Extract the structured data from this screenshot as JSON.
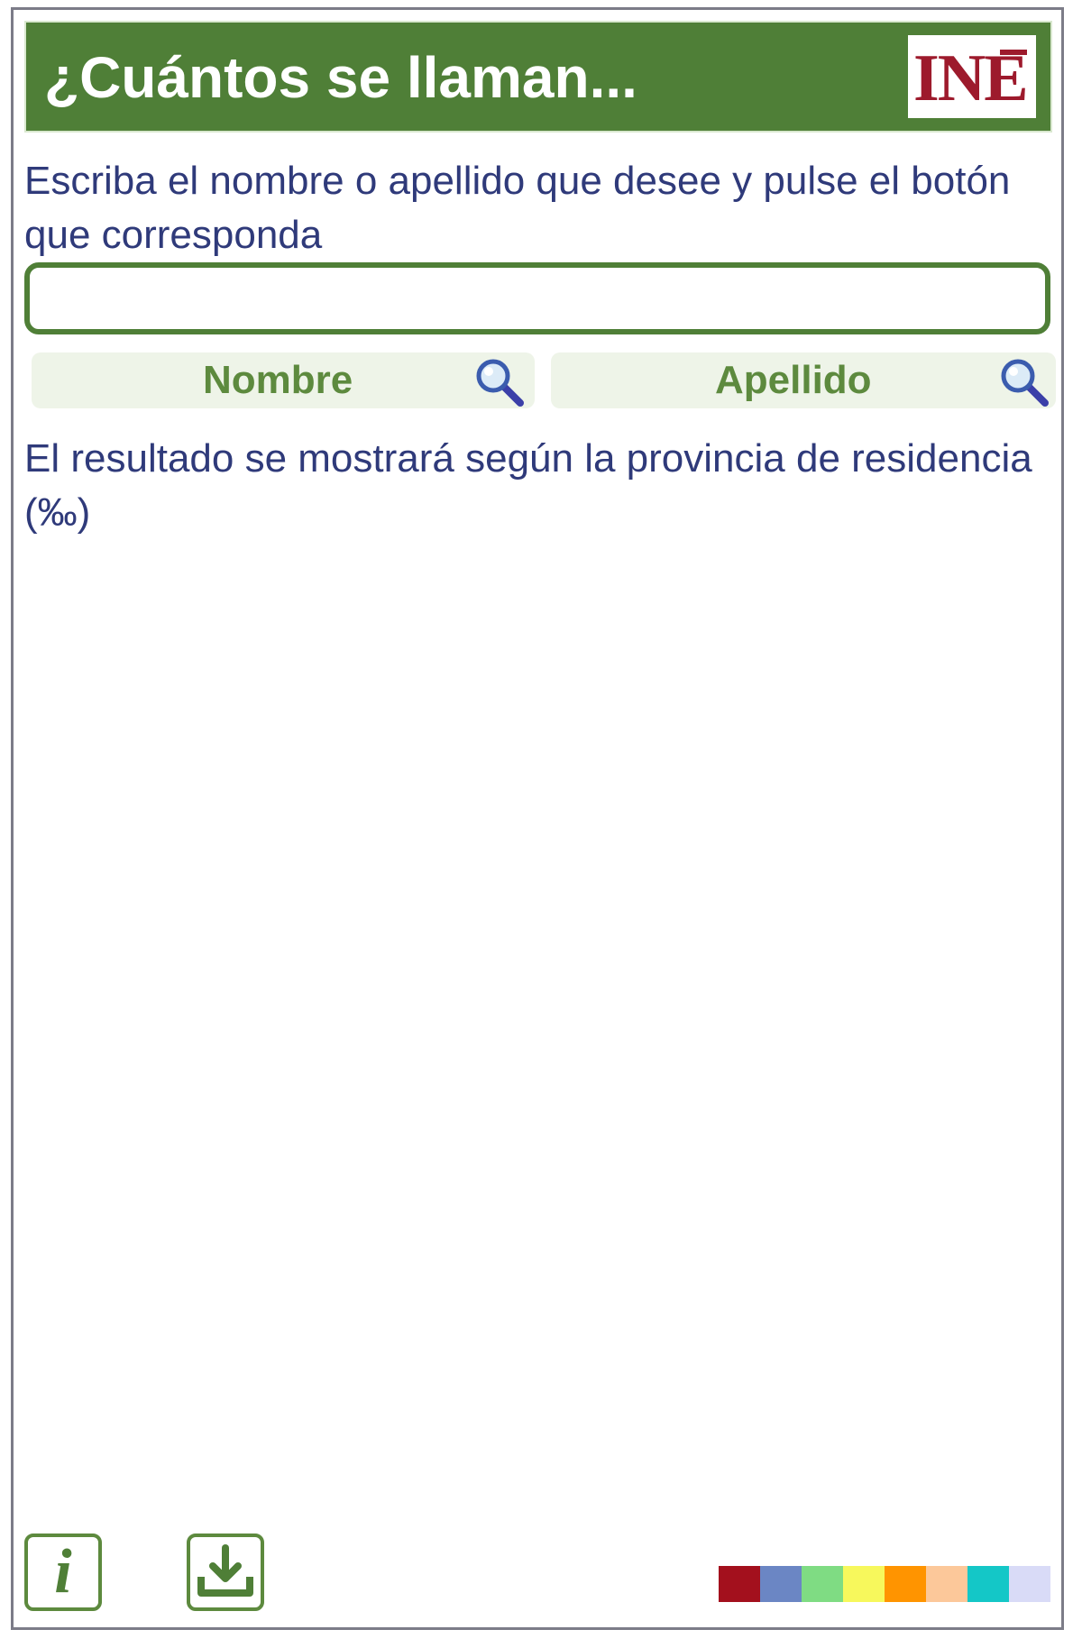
{
  "header": {
    "title": "¿Cuántos se llaman...",
    "logo_text": "INE"
  },
  "instructions": "Escriba el nombre o apellido que desee y pulse el botón que corresponda",
  "search": {
    "value": "",
    "placeholder": ""
  },
  "buttons": {
    "nombre_label": "Nombre",
    "apellido_label": "Apellido"
  },
  "result_note": "El resultado se mostrará según la provincia de residencia (‰)",
  "footer": {
    "info_icon": "info-icon",
    "download_icon": "download-icon",
    "legend_colors": [
      "#a3101d",
      "#6b86c4",
      "#7fdc83",
      "#f7f85c",
      "#ff9400",
      "#fcc89a",
      "#14c7c7",
      "#d9dbf7"
    ]
  },
  "colors": {
    "accent": "#4f7f37",
    "text": "#2f3a7a",
    "button_text": "#5d8a3e",
    "logo": "#9d1a2c"
  }
}
